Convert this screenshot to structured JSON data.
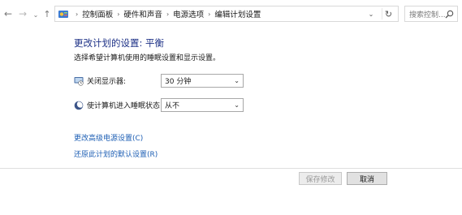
{
  "nav": {
    "back_glyph": "←",
    "forward_glyph": "→",
    "recent_glyph": "⌄",
    "up_glyph": "↑"
  },
  "address": {
    "breadcrumbs": [
      "控制面板",
      "硬件和声音",
      "电源选项",
      "编辑计划设置"
    ],
    "separator": "›",
    "dropdown_glyph": "⌄",
    "refresh_glyph": "↻"
  },
  "search": {
    "placeholder": "搜索控制..."
  },
  "page": {
    "title": "更改计划的设置: 平衡",
    "subtitle": "选择希望计算机使用的睡眠设置和显示设置。"
  },
  "settings": [
    {
      "label": "关闭显示器:",
      "value": "30 分钟",
      "icon": "monitor-icon"
    },
    {
      "label": "使计算机进入睡眠状态:",
      "value": "从不",
      "icon": "moon-icon"
    }
  ],
  "links": {
    "advanced": "更改高级电源设置(C)",
    "restore": "还原此计划的默认设置(R)"
  },
  "buttons": {
    "save": "保存修改",
    "cancel": "取消"
  },
  "colors": {
    "title": "#1e3287",
    "link": "#1e5fb4"
  }
}
